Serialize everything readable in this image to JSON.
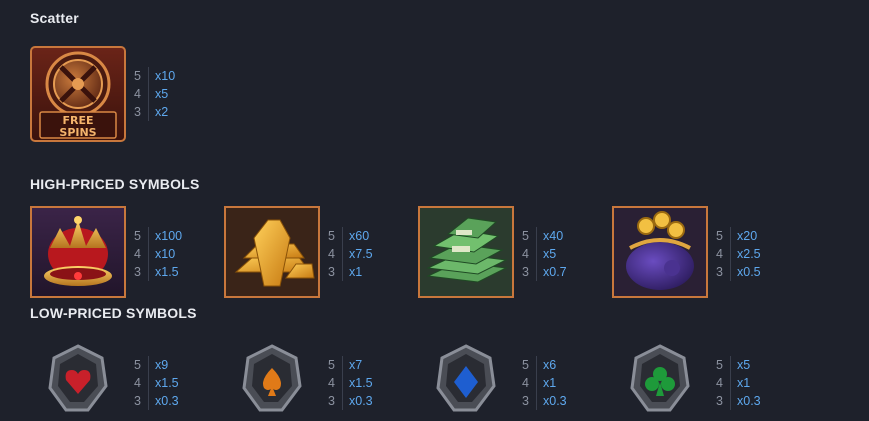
{
  "sections": {
    "scatter": "Scatter",
    "high": "HIGH-PRICED SYMBOLS",
    "low": "LOW-PRICED SYMBOLS"
  },
  "scatter_symbol": {
    "icon": "free-spins-vault-icon",
    "text_line1": "FREE",
    "text_line2": "SPINS",
    "payouts": [
      {
        "count": "5",
        "mult": "x10"
      },
      {
        "count": "4",
        "mult": "x5"
      },
      {
        "count": "3",
        "mult": "x2"
      }
    ]
  },
  "high_symbols": [
    {
      "icon": "crown-icon",
      "payouts": [
        {
          "count": "5",
          "mult": "x100"
        },
        {
          "count": "4",
          "mult": "x10"
        },
        {
          "count": "3",
          "mult": "x1.5"
        }
      ]
    },
    {
      "icon": "gold-bars-icon",
      "payouts": [
        {
          "count": "5",
          "mult": "x60"
        },
        {
          "count": "4",
          "mult": "x7.5"
        },
        {
          "count": "3",
          "mult": "x1"
        }
      ]
    },
    {
      "icon": "cash-stack-icon",
      "payouts": [
        {
          "count": "5",
          "mult": "x40"
        },
        {
          "count": "4",
          "mult": "x5"
        },
        {
          "count": "3",
          "mult": "x0.7"
        }
      ]
    },
    {
      "icon": "coin-purse-icon",
      "payouts": [
        {
          "count": "5",
          "mult": "x20"
        },
        {
          "count": "4",
          "mult": "x2.5"
        },
        {
          "count": "3",
          "mult": "x0.5"
        }
      ]
    }
  ],
  "low_symbols": [
    {
      "icon": "heart-gem-icon",
      "payouts": [
        {
          "count": "5",
          "mult": "x9"
        },
        {
          "count": "4",
          "mult": "x1.5"
        },
        {
          "count": "3",
          "mult": "x0.3"
        }
      ]
    },
    {
      "icon": "spade-gem-icon",
      "payouts": [
        {
          "count": "5",
          "mult": "x7"
        },
        {
          "count": "4",
          "mult": "x1.5"
        },
        {
          "count": "3",
          "mult": "x0.3"
        }
      ]
    },
    {
      "icon": "diamond-gem-icon",
      "payouts": [
        {
          "count": "5",
          "mult": "x6"
        },
        {
          "count": "4",
          "mult": "x1"
        },
        {
          "count": "3",
          "mult": "x0.3"
        }
      ]
    },
    {
      "icon": "club-gem-icon",
      "payouts": [
        {
          "count": "5",
          "mult": "x5"
        },
        {
          "count": "4",
          "mult": "x1"
        },
        {
          "count": "3",
          "mult": "x0.3"
        }
      ]
    }
  ]
}
